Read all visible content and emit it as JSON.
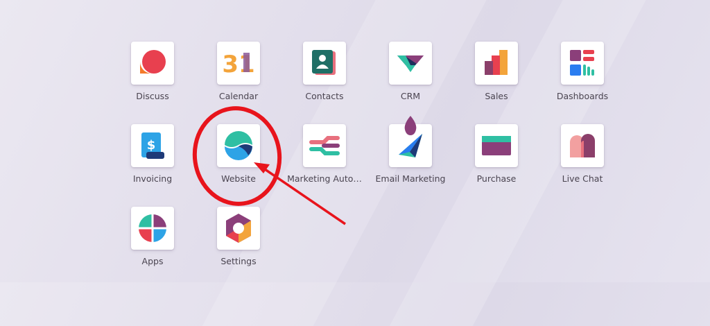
{
  "apps": [
    {
      "id": "discuss",
      "label": "Discuss"
    },
    {
      "id": "calendar",
      "label": "Calendar",
      "icon_text": "31"
    },
    {
      "id": "contacts",
      "label": "Contacts"
    },
    {
      "id": "crm",
      "label": "CRM"
    },
    {
      "id": "sales",
      "label": "Sales"
    },
    {
      "id": "dashboards",
      "label": "Dashboards"
    },
    {
      "id": "invoicing",
      "label": "Invoicing",
      "icon_text": "$"
    },
    {
      "id": "website",
      "label": "Website"
    },
    {
      "id": "marketing-automation",
      "label": "Marketing Auto…"
    },
    {
      "id": "email-marketing",
      "label": "Email Marketing"
    },
    {
      "id": "purchase",
      "label": "Purchase"
    },
    {
      "id": "live-chat",
      "label": "Live Chat"
    },
    {
      "id": "apps",
      "label": "Apps"
    },
    {
      "id": "settings",
      "label": "Settings"
    }
  ],
  "annotation": {
    "color": "#e8141c",
    "target": "website"
  },
  "colors": {
    "background": "#e4e0ec",
    "label": "#4a4450",
    "tile": "#ffffff"
  }
}
